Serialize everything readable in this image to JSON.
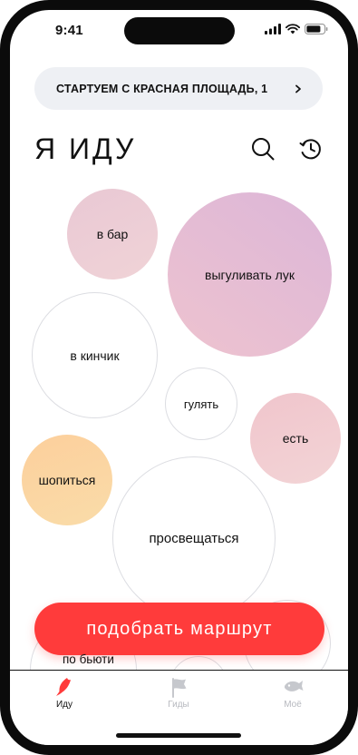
{
  "status": {
    "time": "9:41"
  },
  "start": {
    "label": "СТАРТУЕМ С КРАСНАЯ ПЛОЩАДЬ, 1"
  },
  "header": {
    "title": "Я ИДУ"
  },
  "bubbles": {
    "bar": "в бар",
    "luk": "выгуливать лук",
    "kinchik": "в кинчик",
    "gulyat": "гулять",
    "est": "есть",
    "shopitsya": "шопиться",
    "prosveshchatsya": "просвещаться",
    "po_byuti": "по бьюти"
  },
  "cta": {
    "label": "подобрать маршрут"
  },
  "tabs": [
    {
      "label": "Иду",
      "active": true
    },
    {
      "label": "Гиды",
      "active": false
    },
    {
      "label": "Моё",
      "active": false
    }
  ],
  "colors": {
    "accent": "#ff3b3b",
    "muted": "#b7b9bf"
  }
}
